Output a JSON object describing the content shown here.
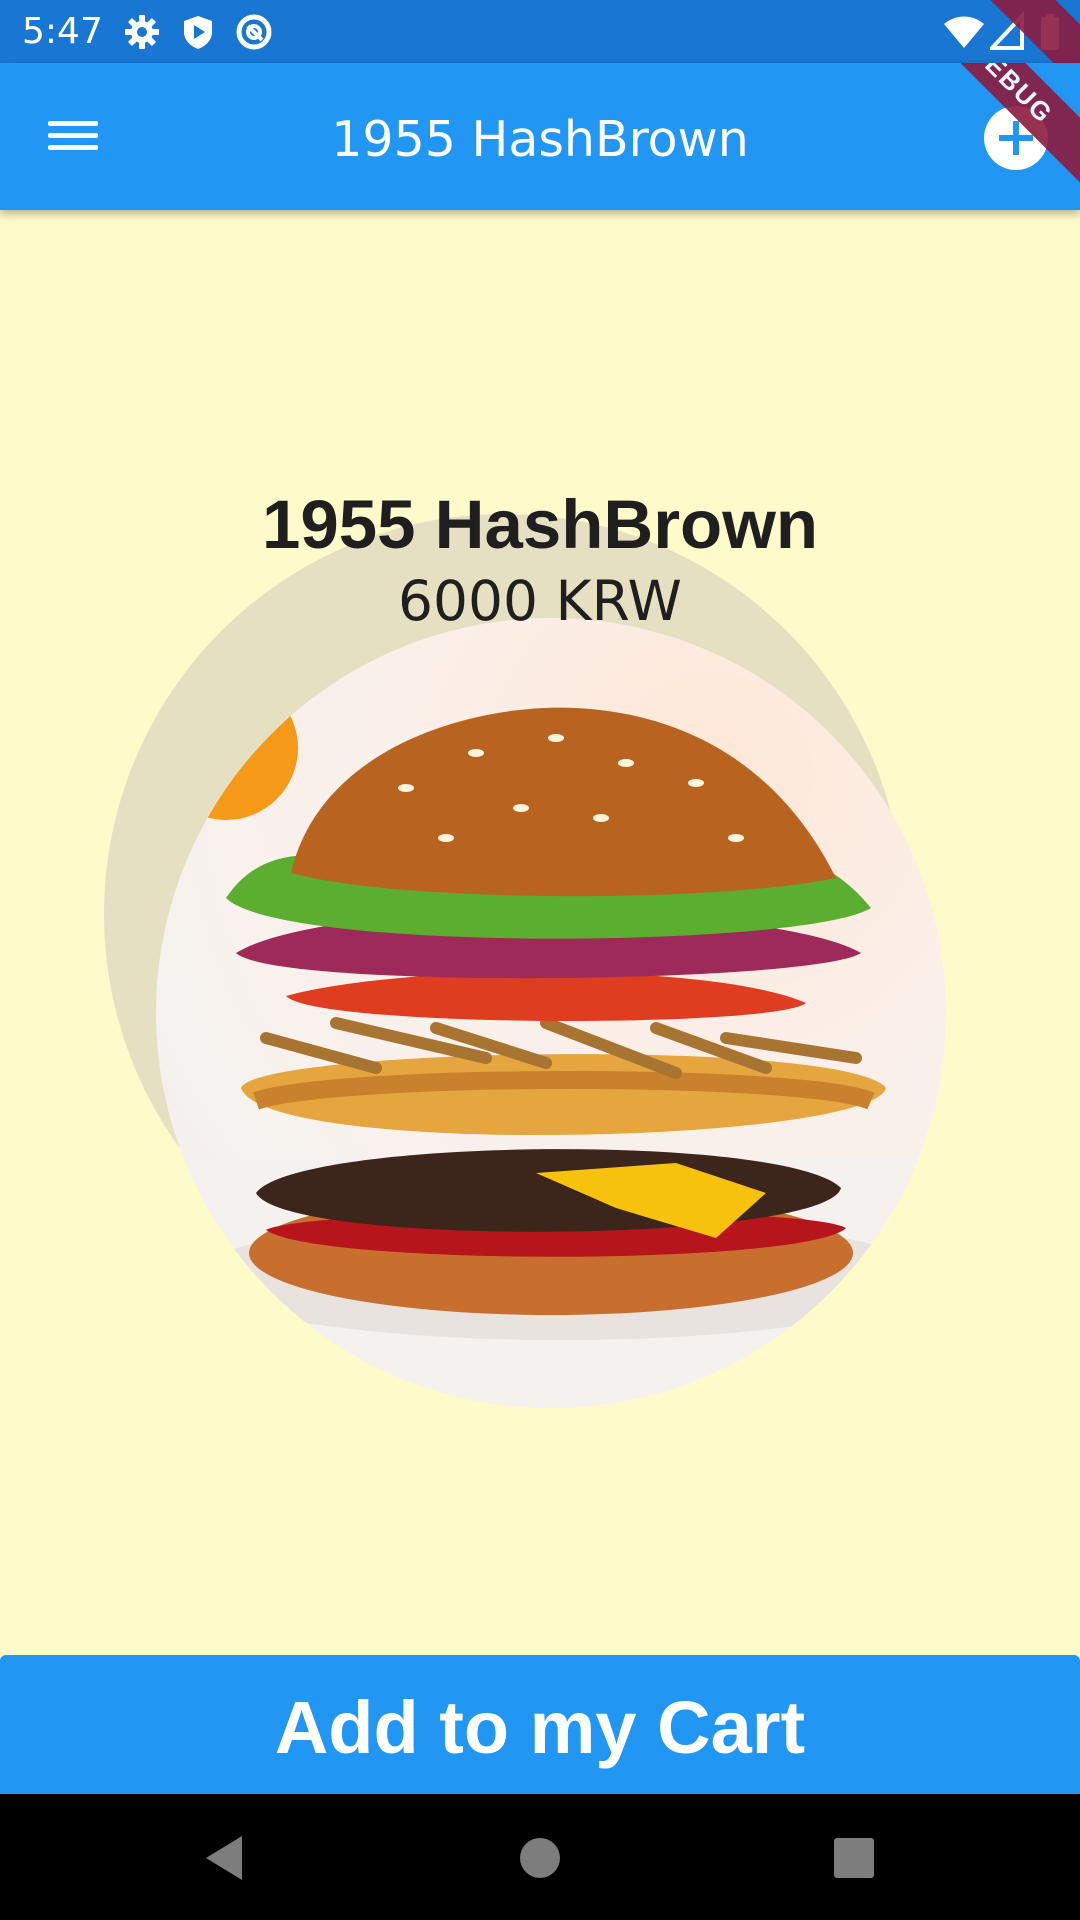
{
  "status_bar": {
    "time": "5:47",
    "left_icons": [
      "gear-icon",
      "shield-play-icon",
      "at-sign-icon"
    ],
    "right_icons": [
      "wifi-icon",
      "signal-icon",
      "battery-icon"
    ],
    "debug_label": "DEBUG"
  },
  "app_bar": {
    "title": "1955 HashBrown",
    "menu_icon": "hamburger-menu-icon",
    "add_icon": "plus-circle-icon"
  },
  "product": {
    "name": "1955 HashBrown",
    "price": "6000 KRW",
    "image": "burger-photo"
  },
  "cart_button": {
    "label": "Add to my Cart"
  },
  "navigation": {
    "back_icon": "back-triangle-icon",
    "home_icon": "home-circle-icon",
    "recents_icon": "recents-square-icon"
  },
  "colors": {
    "primary": "#2196f3",
    "status_bar": "#1976d2",
    "background": "#fffaca",
    "debug_ribbon": "#8a1c3f"
  }
}
